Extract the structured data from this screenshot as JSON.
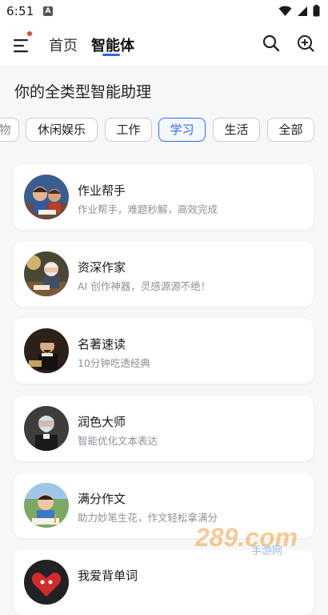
{
  "status_bar": {
    "time": "6:51",
    "notification_letter": "A"
  },
  "header": {
    "tabs": [
      {
        "label": "首页",
        "selected": false
      },
      {
        "label": "智能体",
        "selected": true
      }
    ]
  },
  "tagline": "你的全类型智能助理",
  "categories": [
    {
      "label": "物",
      "selected": false
    },
    {
      "label": "休闲娱乐",
      "selected": false
    },
    {
      "label": "工作",
      "selected": false
    },
    {
      "label": "学习",
      "selected": true
    },
    {
      "label": "生活",
      "selected": false
    },
    {
      "label": "全部",
      "selected": false
    }
  ],
  "agents": [
    {
      "title": "作业帮手",
      "description": "作业帮手，难题秒解，高效完成",
      "avatar": "kids-studying-avatar"
    },
    {
      "title": "资深作家",
      "description": "AI 创作神器，灵感源源不绝！",
      "avatar": "old-writer-avatar"
    },
    {
      "title": "名著速读",
      "description": "10分钟吃透经典",
      "avatar": "shakespeare-avatar"
    },
    {
      "title": "润色大师",
      "description": "智能优化文本表达",
      "avatar": "author-portrait-avatar"
    },
    {
      "title": "满分作文",
      "description": "助力妙笔生花，作文轻松拿满分",
      "avatar": "child-writing-avatar"
    },
    {
      "title": "我爱背单词",
      "description": "",
      "avatar": "heart-mascot-avatar"
    }
  ],
  "watermark": {
    "text": "289.com",
    "subtext": "手游网"
  },
  "colors": {
    "accent": "#2e6bf0",
    "notification_dot": "#e8413b",
    "background": "#f6f7f9"
  }
}
